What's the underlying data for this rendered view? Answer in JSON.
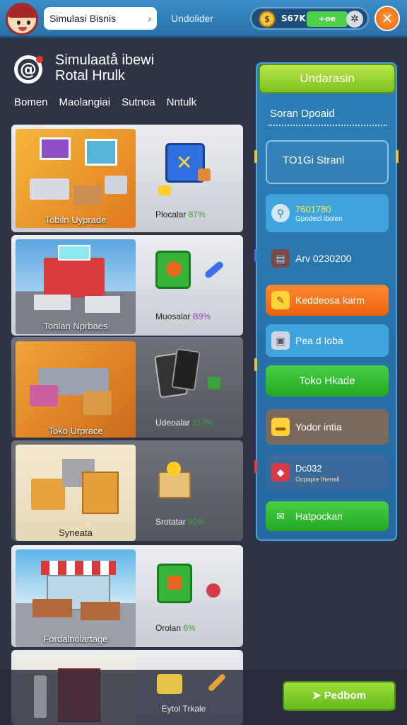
{
  "topbar": {
    "search_text": "Simulasi Bisnis",
    "title": "Undolider",
    "coin_value": "S67K",
    "xp_label": "+oe",
    "close_symbol": "✕"
  },
  "header": {
    "title_line1": "Simulaatå ibewi",
    "title_line2": "Rotal Hrulk",
    "tabs": [
      "Bomen",
      "Maolangiai",
      "Sutnoa",
      "Nntulk"
    ]
  },
  "cards": [
    {
      "scene_label": "Tobiln Uyprade",
      "caption": "Plocalar",
      "pct": "87%"
    },
    {
      "scene_label": "Tonlan Nprbaes",
      "caption": "Muosalar",
      "pct": "B9%"
    },
    {
      "scene_label": "Toko Urprace",
      "caption": "Udeoalar",
      "pct": "117%"
    },
    {
      "scene_label": "Syneata",
      "caption": "Srotatar",
      "pct": "80%"
    },
    {
      "scene_label": "Fordalnolartage",
      "caption": "Orolan",
      "pct": "6%"
    },
    {
      "scene_label": "",
      "caption": "Eytol Trkale",
      "pct": ""
    }
  ],
  "rpanel": {
    "header": "Undarasin",
    "subtitle": "Soran Dpoaid",
    "box_label": "TO1Gi  Stranl",
    "buttons": [
      {
        "line1": "7601780",
        "line2": "Gpodecl ibolen"
      },
      {
        "line1": "Arv 0230200",
        "line2": ""
      },
      {
        "line1": "Keddeosa karm",
        "line2": ""
      },
      {
        "line1": "Pea d Ioba",
        "line2": ""
      },
      {
        "line1": "Toko Hkade",
        "line2": ""
      },
      {
        "line1": "Yodor intia",
        "line2": ""
      },
      {
        "line1": "Dc032",
        "line2": "Ocpapie Ihenall"
      },
      {
        "line1": "Hatpockan",
        "line2": ""
      }
    ]
  },
  "bottom": {
    "button_label": "Pedbom"
  },
  "colors": {
    "topbar": "#2a70a8",
    "panel": "#2569a0",
    "green": "#66b81b",
    "orange": "#f07a1a",
    "close": "#e8640e"
  }
}
